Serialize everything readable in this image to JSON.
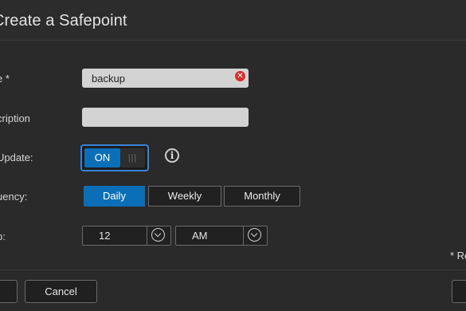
{
  "dialog": {
    "title": "Create a Safepoint"
  },
  "form": {
    "name_label": "e *",
    "name_value": "backup",
    "description_label": "cription",
    "description_value": "",
    "auto_update_label": "Update:",
    "auto_update_state": "ON",
    "auto_update_knob": "|||",
    "frequency_label": "uency:",
    "frequency_options": [
      "Daily",
      "Weekly",
      "Monthly"
    ],
    "frequency_selected": "Daily",
    "time_label": "p:",
    "time_hour": "12",
    "time_meridiem": "AM",
    "required_note": "* Re"
  },
  "footer": {
    "cancel_label": "Cancel"
  },
  "colors": {
    "accent": "#0b6fb7",
    "focus_ring": "#3a82d6",
    "clear_icon": "#d8322b",
    "background": "#2a2a2a"
  },
  "icons": {
    "clear": "clear-icon",
    "info": "info-icon",
    "dropdown": "chevron-down-icon"
  }
}
